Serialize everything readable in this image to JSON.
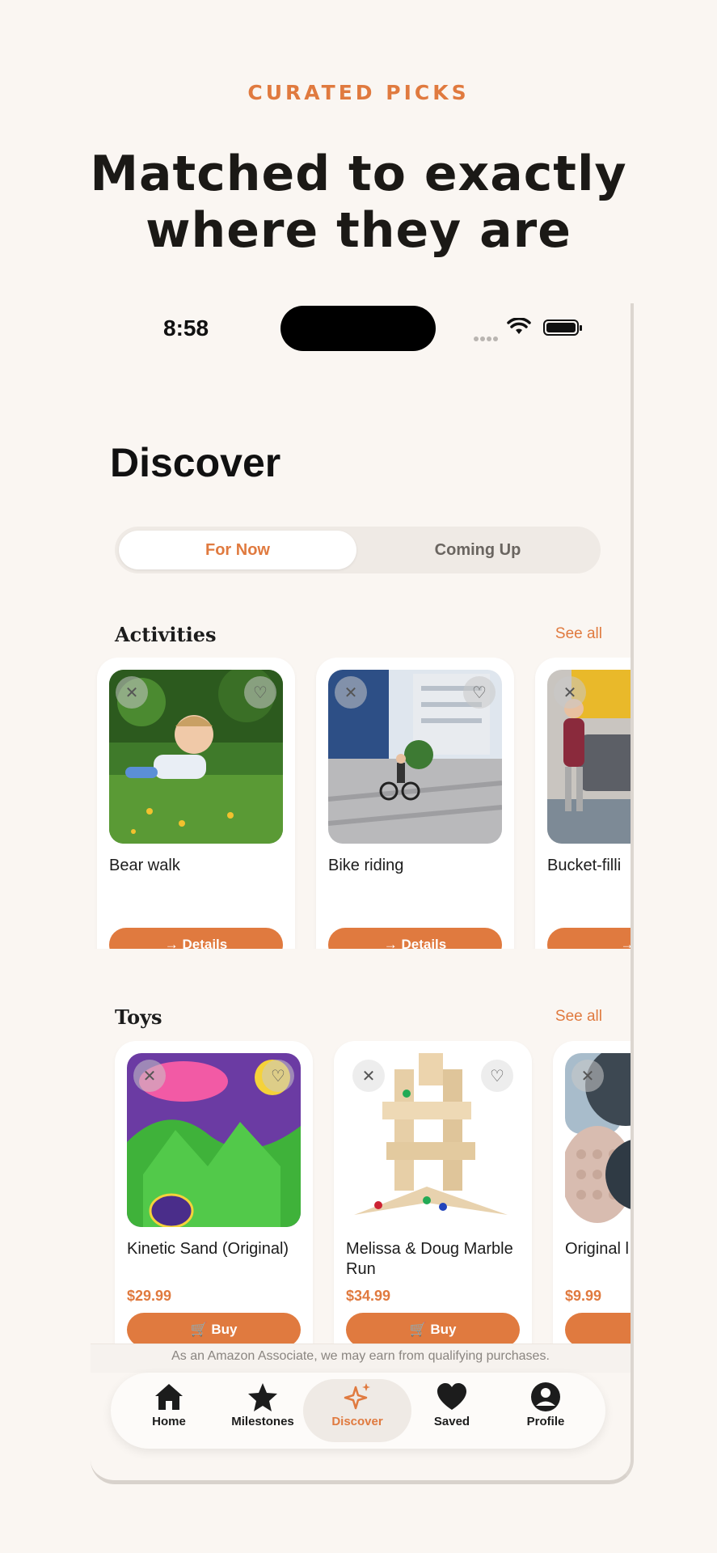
{
  "header": {
    "eyebrow": "CURATED PICKS",
    "headline_line1": "Matched to exactly",
    "headline_line2": "where they are"
  },
  "status_bar": {
    "time": "8:58"
  },
  "page": {
    "title": "Discover"
  },
  "segmented": {
    "options": [
      "For Now",
      "Coming Up"
    ],
    "selected": "For Now"
  },
  "activities": {
    "title": "Activities",
    "see_all": "See all",
    "items": [
      {
        "name": "Bear walk",
        "button": "Details"
      },
      {
        "name": "Bike riding",
        "button": "Details"
      },
      {
        "name": "Bucket-filli",
        "button": "D"
      }
    ]
  },
  "toys": {
    "title": "Toys",
    "see_all": "See all",
    "items": [
      {
        "name": "Kinetic Sand (Original)",
        "price": "$29.99",
        "button": "Buy"
      },
      {
        "name": "Melissa & Doug Marble Run",
        "price": "$34.99",
        "button": "Buy"
      },
      {
        "name": "Original l fidget toy",
        "price": "$9.99",
        "button": ""
      }
    ]
  },
  "disclaimer": "As an Amazon Associate, we may earn from qualifying purchases.",
  "tabbar": {
    "items": [
      "Home",
      "Milestones",
      "Discover",
      "Saved",
      "Profile"
    ],
    "active": "Discover"
  },
  "colors": {
    "accent": "#e07a3f",
    "background": "#faf6f2",
    "text": "#1a1a1a"
  }
}
